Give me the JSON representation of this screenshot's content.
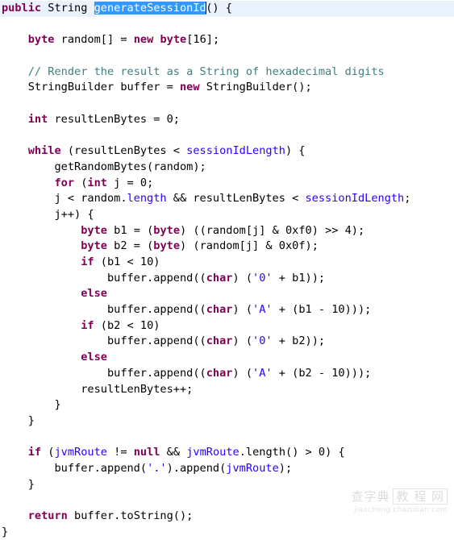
{
  "editor": {
    "language": "Java",
    "font_size_px": 13.6,
    "line_height_px": 19.7,
    "background_color": "#ffffff",
    "current_line_highlight_color": "#e9f2fd",
    "selection_background_color": "#3399ff",
    "selection_text_color": "#ffffff",
    "keyword_color": "#7f0055",
    "field_color": "#2a00ff",
    "string_color": "#2a00ff",
    "comment_color": "#3f7f7f",
    "plain_text_color": "#000000",
    "selected_text": "generateSessionId",
    "caret_after_selection": true
  },
  "lines": [
    {
      "n": 1,
      "current": true,
      "tokens": [
        {
          "t": "public",
          "c": "kw"
        },
        {
          "t": " ",
          "c": "pln"
        },
        {
          "t": "String",
          "c": "pln"
        },
        {
          "t": " ",
          "c": "pln"
        },
        {
          "t": "generateSessionId",
          "c": "sel"
        },
        {
          "t": "caret",
          "c": "caret"
        },
        {
          "t": "() {",
          "c": "pln"
        }
      ]
    },
    {
      "n": 2,
      "current": false,
      "tokens": []
    },
    {
      "n": 3,
      "current": false,
      "tokens": [
        {
          "t": "    ",
          "c": "pln"
        },
        {
          "t": "byte",
          "c": "kw"
        },
        {
          "t": " random[] = ",
          "c": "pln"
        },
        {
          "t": "new",
          "c": "kw"
        },
        {
          "t": " ",
          "c": "pln"
        },
        {
          "t": "byte",
          "c": "kw"
        },
        {
          "t": "[16];",
          "c": "pln"
        }
      ]
    },
    {
      "n": 4,
      "current": false,
      "tokens": []
    },
    {
      "n": 5,
      "current": false,
      "tokens": [
        {
          "t": "    ",
          "c": "pln"
        },
        {
          "t": "// Render the result as a String of hexadecimal digits",
          "c": "cmt"
        }
      ]
    },
    {
      "n": 6,
      "current": false,
      "tokens": [
        {
          "t": "    StringBuilder buffer = ",
          "c": "pln"
        },
        {
          "t": "new",
          "c": "kw"
        },
        {
          "t": " StringBuilder();",
          "c": "pln"
        }
      ]
    },
    {
      "n": 7,
      "current": false,
      "tokens": []
    },
    {
      "n": 8,
      "current": false,
      "tokens": [
        {
          "t": "    ",
          "c": "pln"
        },
        {
          "t": "int",
          "c": "kw"
        },
        {
          "t": " resultLenBytes = 0;",
          "c": "pln"
        }
      ]
    },
    {
      "n": 9,
      "current": false,
      "tokens": []
    },
    {
      "n": 10,
      "current": false,
      "tokens": [
        {
          "t": "    ",
          "c": "pln"
        },
        {
          "t": "while",
          "c": "kw"
        },
        {
          "t": " (resultLenBytes < ",
          "c": "pln"
        },
        {
          "t": "sessionIdLength",
          "c": "fld"
        },
        {
          "t": ") {",
          "c": "pln"
        }
      ]
    },
    {
      "n": 11,
      "current": false,
      "tokens": [
        {
          "t": "        getRandomBytes(random);",
          "c": "pln"
        }
      ]
    },
    {
      "n": 12,
      "current": false,
      "tokens": [
        {
          "t": "        ",
          "c": "pln"
        },
        {
          "t": "for",
          "c": "kw"
        },
        {
          "t": " (",
          "c": "pln"
        },
        {
          "t": "int",
          "c": "kw"
        },
        {
          "t": " j = 0;",
          "c": "pln"
        }
      ]
    },
    {
      "n": 13,
      "current": false,
      "tokens": [
        {
          "t": "        j < random.",
          "c": "pln"
        },
        {
          "t": "length",
          "c": "fld"
        },
        {
          "t": " && resultLenBytes < ",
          "c": "pln"
        },
        {
          "t": "sessionIdLength",
          "c": "fld"
        },
        {
          "t": ";",
          "c": "pln"
        }
      ]
    },
    {
      "n": 14,
      "current": false,
      "tokens": [
        {
          "t": "        j++) {",
          "c": "pln"
        }
      ]
    },
    {
      "n": 15,
      "current": false,
      "tokens": [
        {
          "t": "            ",
          "c": "pln"
        },
        {
          "t": "byte",
          "c": "kw"
        },
        {
          "t": " b1 = (",
          "c": "pln"
        },
        {
          "t": "byte",
          "c": "kw"
        },
        {
          "t": ") ((random[j] & 0xf0) >> 4);",
          "c": "pln"
        }
      ]
    },
    {
      "n": 16,
      "current": false,
      "tokens": [
        {
          "t": "            ",
          "c": "pln"
        },
        {
          "t": "byte",
          "c": "kw"
        },
        {
          "t": " b2 = (",
          "c": "pln"
        },
        {
          "t": "byte",
          "c": "kw"
        },
        {
          "t": ") (random[j] & 0x0f);",
          "c": "pln"
        }
      ]
    },
    {
      "n": 17,
      "current": false,
      "tokens": [
        {
          "t": "            ",
          "c": "pln"
        },
        {
          "t": "if",
          "c": "kw"
        },
        {
          "t": " (b1 < 10)",
          "c": "pln"
        }
      ]
    },
    {
      "n": 18,
      "current": false,
      "tokens": [
        {
          "t": "                buffer.append((",
          "c": "pln"
        },
        {
          "t": "char",
          "c": "kw"
        },
        {
          "t": ") (",
          "c": "pln"
        },
        {
          "t": "'0'",
          "c": "str"
        },
        {
          "t": " + b1));",
          "c": "pln"
        }
      ]
    },
    {
      "n": 19,
      "current": false,
      "tokens": [
        {
          "t": "            ",
          "c": "pln"
        },
        {
          "t": "else",
          "c": "kw"
        }
      ]
    },
    {
      "n": 20,
      "current": false,
      "tokens": [
        {
          "t": "                buffer.append((",
          "c": "pln"
        },
        {
          "t": "char",
          "c": "kw"
        },
        {
          "t": ") (",
          "c": "pln"
        },
        {
          "t": "'A'",
          "c": "str"
        },
        {
          "t": " + (b1 - 10)));",
          "c": "pln"
        }
      ]
    },
    {
      "n": 21,
      "current": false,
      "tokens": [
        {
          "t": "            ",
          "c": "pln"
        },
        {
          "t": "if",
          "c": "kw"
        },
        {
          "t": " (b2 < 10)",
          "c": "pln"
        }
      ]
    },
    {
      "n": 22,
      "current": false,
      "tokens": [
        {
          "t": "                buffer.append((",
          "c": "pln"
        },
        {
          "t": "char",
          "c": "kw"
        },
        {
          "t": ") (",
          "c": "pln"
        },
        {
          "t": "'0'",
          "c": "str"
        },
        {
          "t": " + b2));",
          "c": "pln"
        }
      ]
    },
    {
      "n": 23,
      "current": false,
      "tokens": [
        {
          "t": "            ",
          "c": "pln"
        },
        {
          "t": "else",
          "c": "kw"
        }
      ]
    },
    {
      "n": 24,
      "current": false,
      "tokens": [
        {
          "t": "                buffer.append((",
          "c": "pln"
        },
        {
          "t": "char",
          "c": "kw"
        },
        {
          "t": ") (",
          "c": "pln"
        },
        {
          "t": "'A'",
          "c": "str"
        },
        {
          "t": " + (b2 - 10)));",
          "c": "pln"
        }
      ]
    },
    {
      "n": 25,
      "current": false,
      "tokens": [
        {
          "t": "            resultLenBytes++;",
          "c": "pln"
        }
      ]
    },
    {
      "n": 26,
      "current": false,
      "tokens": [
        {
          "t": "        }",
          "c": "pln"
        }
      ]
    },
    {
      "n": 27,
      "current": false,
      "tokens": [
        {
          "t": "    }",
          "c": "pln"
        }
      ]
    },
    {
      "n": 28,
      "current": false,
      "tokens": []
    },
    {
      "n": 29,
      "current": false,
      "tokens": [
        {
          "t": "    ",
          "c": "pln"
        },
        {
          "t": "if",
          "c": "kw"
        },
        {
          "t": " (",
          "c": "pln"
        },
        {
          "t": "jvmRoute",
          "c": "fld"
        },
        {
          "t": " != ",
          "c": "pln"
        },
        {
          "t": "null",
          "c": "kw"
        },
        {
          "t": " && ",
          "c": "pln"
        },
        {
          "t": "jvmRoute",
          "c": "fld"
        },
        {
          "t": ".length() > 0) {",
          "c": "pln"
        }
      ]
    },
    {
      "n": 30,
      "current": false,
      "tokens": [
        {
          "t": "        buffer.append(",
          "c": "pln"
        },
        {
          "t": "'.'",
          "c": "str"
        },
        {
          "t": ").append(",
          "c": "pln"
        },
        {
          "t": "jvmRoute",
          "c": "fld"
        },
        {
          "t": ");",
          "c": "pln"
        }
      ]
    },
    {
      "n": 31,
      "current": false,
      "tokens": [
        {
          "t": "    }",
          "c": "pln"
        }
      ]
    },
    {
      "n": 32,
      "current": false,
      "tokens": []
    },
    {
      "n": 33,
      "current": false,
      "tokens": [
        {
          "t": "    ",
          "c": "pln"
        },
        {
          "t": "return",
          "c": "kw"
        },
        {
          "t": " buffer.toString();",
          "c": "pln"
        }
      ]
    },
    {
      "n": 34,
      "current": false,
      "tokens": [
        {
          "t": "}",
          "c": "pln"
        }
      ]
    }
  ],
  "watermark": {
    "logo_text": "查字典",
    "boxed_text": "教 程 网",
    "url": "jiaocheng.chazidian.com"
  }
}
